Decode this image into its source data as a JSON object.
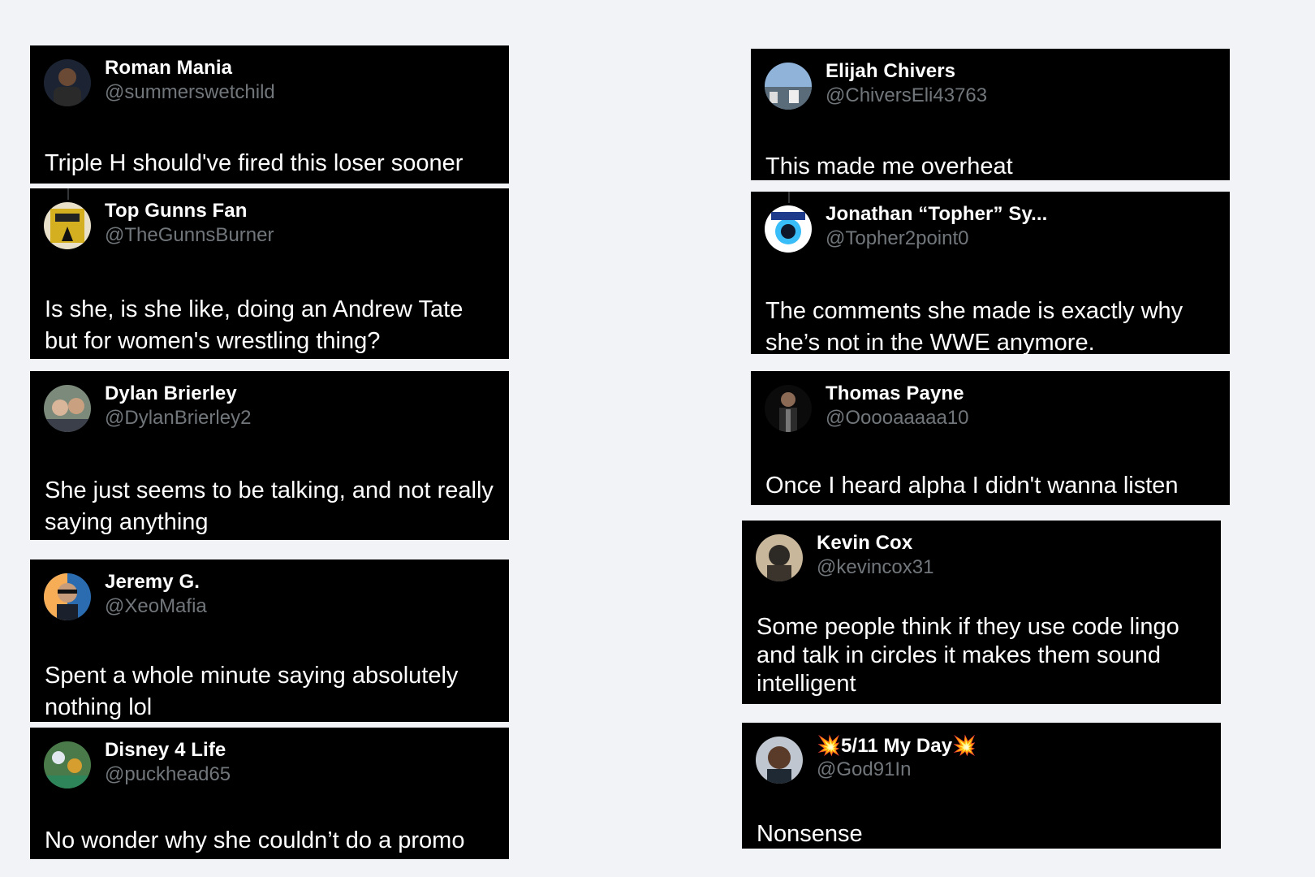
{
  "left_column": [
    {
      "name": "Roman Mania",
      "handle": "@summerswetchild",
      "text": "Triple H should've fired this loser sooner"
    },
    {
      "name": "Top Gunns Fan",
      "handle": "@TheGunnsBurner",
      "text": "Is she, is she like, doing an Andrew Tate but for women's wrestling thing?"
    },
    {
      "name": "Dylan Brierley",
      "handle": "@DylanBrierley2",
      "text": "She just seems to be talking, and not really saying anything"
    },
    {
      "name": "Jeremy G.",
      "handle": "@XeoMafia",
      "text": "Spent a whole minute saying absolutely nothing lol"
    },
    {
      "name": "Disney 4 Life",
      "handle": "@puckhead65",
      "text": "No wonder why she couldn’t do a promo"
    }
  ],
  "right_column": [
    {
      "name": "Elijah Chivers",
      "handle": "@ChiversEli43763",
      "text": "This made me overheat"
    },
    {
      "name": "Jonathan “Topher” Sy...",
      "handle": "@Topher2point0",
      "text": "The comments she made is exactly why she’s not in the WWE anymore."
    },
    {
      "name": "Thomas Payne",
      "handle": "@Ooooaaaaa10",
      "text": "Once I heard alpha I didn't wanna listen"
    },
    {
      "name": "Kevin Cox",
      "handle": "@kevincox31",
      "text": "Some people think if they use code lingo and talk in circles it makes them sound intelligent"
    },
    {
      "name": "💥5/11 My Day💥",
      "handle": "@God91In",
      "text": "Nonsense"
    }
  ],
  "colors": {
    "card_bg": "#000000",
    "handle": "#71767b",
    "page_bg": "#f1f3f7"
  }
}
